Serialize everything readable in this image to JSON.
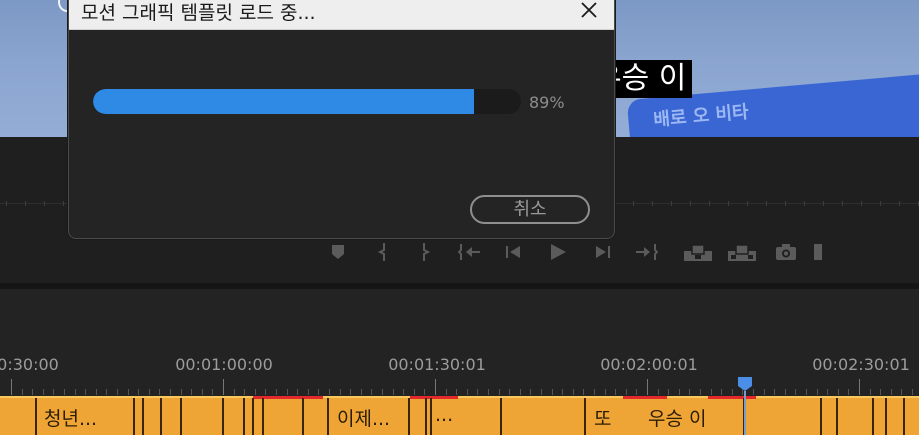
{
  "dialog": {
    "title": "모션 그래픽 템플릿 로드 중...",
    "progress_percent": 89,
    "progress_label": "89%",
    "cancel_label": "취소"
  },
  "preview": {
    "caption": "우승 이",
    "card_text": "배로 오 비타"
  },
  "timeline": {
    "timecodes": [
      "0:30:00",
      "00:01:00:00",
      "00:01:30:01",
      "00:02:00:01",
      "00:02:30:01"
    ],
    "clip_labels": [
      "청년...",
      "이제...",
      "...",
      "또",
      "우승 이"
    ]
  },
  "colors": {
    "progress_fill": "#2f8ae5",
    "clip_color": "#efa436",
    "playhead": "#4a8ee8",
    "marker_red": "#e3282b"
  },
  "icons": {
    "toolbar": [
      "add-marker-icon",
      "mark-in-icon",
      "mark-out-icon",
      "go-to-in-icon",
      "step-back-icon",
      "play-icon",
      "step-forward-icon",
      "go-to-out-icon",
      "insert-icon",
      "overwrite-icon",
      "export-frame-icon"
    ]
  }
}
